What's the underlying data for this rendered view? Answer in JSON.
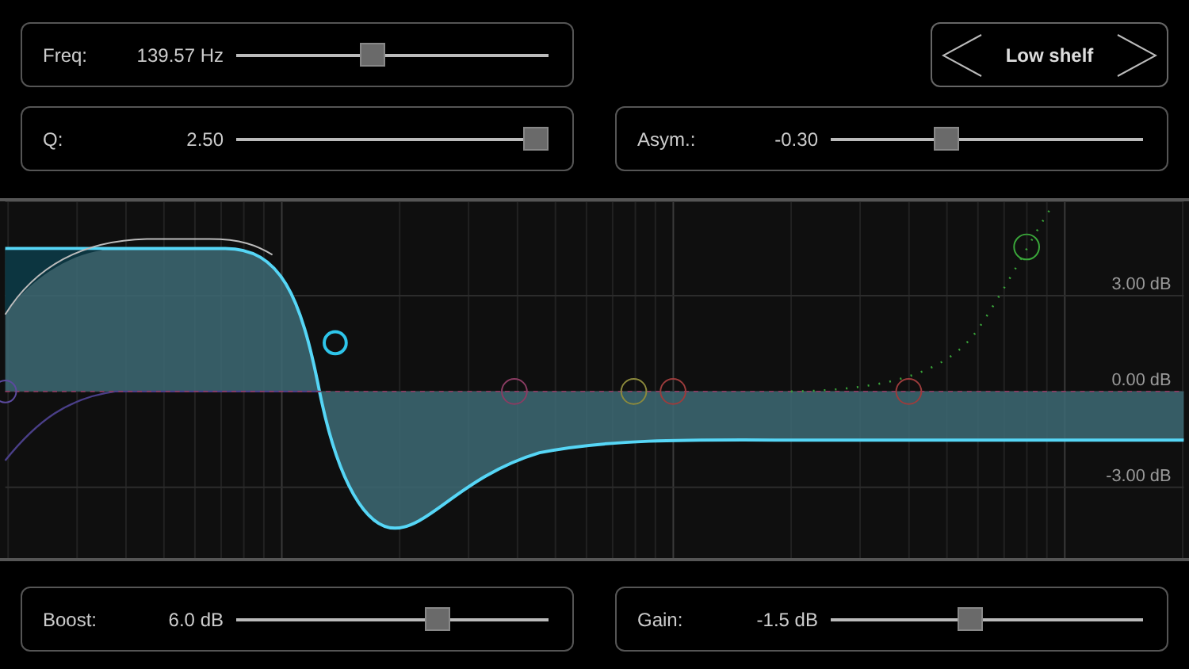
{
  "top_left": [
    {
      "label": "Freq:",
      "value": "139.57 Hz",
      "level": 0.43
    },
    {
      "label": "Q:",
      "value": "2.50",
      "level": 1.0
    }
  ],
  "filter_type": {
    "label": "Low shelf"
  },
  "top_right": {
    "label": "Asym.:",
    "value": "-0.30",
    "level": 0.36
  },
  "graph": {
    "db_labels": [
      "3.00 dB",
      "0.00 dB",
      "-3.00 dB"
    ],
    "bands": [
      {
        "color": "#2ec5ea"
      },
      {
        "color": "#5b4a9e"
      },
      {
        "color": "#8a3c62"
      },
      {
        "color": "#8c8a3c"
      },
      {
        "color": "#9c3c3c"
      },
      {
        "color": "#9c3c3c"
      },
      {
        "color": "#3aa63a"
      }
    ]
  },
  "bottom": [
    {
      "label": "Boost:",
      "value": "6.0 dB",
      "level": 0.66
    },
    {
      "label": "Gain:",
      "value": "-1.5 dB",
      "level": 0.44
    }
  ]
}
